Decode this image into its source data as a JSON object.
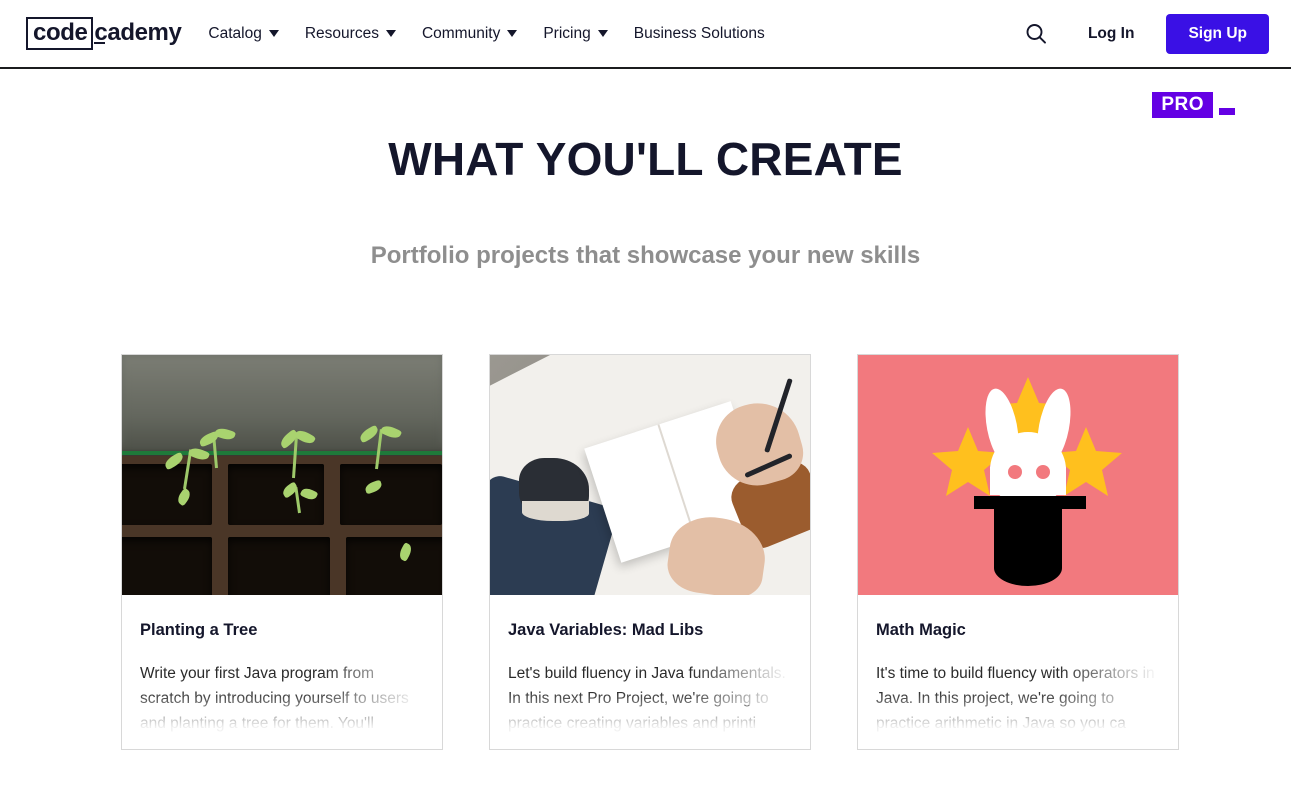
{
  "header": {
    "logo": {
      "boxed_text": "code",
      "rest_text": "cademy",
      "name": "codecademy"
    },
    "nav_items": [
      {
        "label": "Catalog",
        "has_caret": true
      },
      {
        "label": "Resources",
        "has_caret": true
      },
      {
        "label": "Community",
        "has_caret": true
      },
      {
        "label": "Pricing",
        "has_caret": true
      },
      {
        "label": "Business Solutions",
        "has_caret": false
      }
    ],
    "search_icon": "search-icon",
    "login_label": "Log In",
    "signup_label": "Sign Up",
    "signup_color": "#3a10e5"
  },
  "pro_badge": {
    "label": "PRO",
    "color": "#6400e4",
    "text_color": "#ffffff"
  },
  "hero": {
    "title": "WHAT YOU'LL CREATE",
    "subtitle": "Portfolio projects that showcase your new skills",
    "title_color": "#14162b",
    "subtitle_color": "#8e8e8e"
  },
  "cards": [
    {
      "title": "Planting a Tree",
      "description": "Write your first Java program from scratch by introducing yourself to users and planting a tree for them. You'll",
      "image": "seedlings-in-soil-tray-photo",
      "image_alt": "Green seedlings sprouting from a brown soil seed tray"
    },
    {
      "title": "Java Variables: Mad Libs",
      "description": "Let's build fluency in Java fundamentals. In this next Pro Project, we're going to practice creating variables and printi",
      "image": "person-writing-in-notebook-photo",
      "image_alt": "Overhead view of a person writing with a pen in an open notebook"
    },
    {
      "title": "Math Magic",
      "description": "It's time to build fluency with operators in Java. In this project, we're going to practice arithmetic in Java so you ca",
      "image": "rabbit-in-magic-hat-illustration",
      "image_alt": "White rabbit popping out of a black top hat with yellow stars",
      "image_bg": "#F2797E",
      "star_color": "#FFC01E"
    }
  ]
}
